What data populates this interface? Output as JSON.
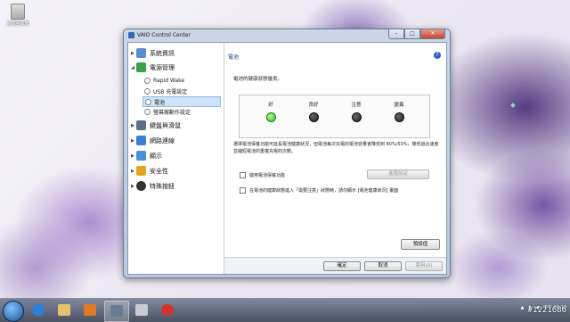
{
  "desktop": {
    "icon_label": "資源回收筒"
  },
  "window": {
    "title": "VAIO Control Center",
    "buttons": {
      "minimize": "–",
      "maximize": "□",
      "close": "✕"
    }
  },
  "sidebar": {
    "items": [
      {
        "label": "系統資訊",
        "icon": "computer-icon",
        "color": "#5b8bd0"
      },
      {
        "label": "電源管理",
        "icon": "battery-plug-icon",
        "color": "#3aa04a"
      },
      {
        "label": "鍵盤與滑鼠",
        "icon": "keyboard-icon",
        "color": "#5c6f88"
      },
      {
        "label": "網路連線",
        "icon": "network-icon",
        "color": "#3a7fd0"
      },
      {
        "label": "顯示",
        "icon": "display-icon",
        "color": "#4a90d8"
      },
      {
        "label": "安全性",
        "icon": "lock-icon",
        "color": "#e0a820"
      },
      {
        "label": "特殊按鈕",
        "icon": "special-button-icon",
        "color": "#333333"
      }
    ],
    "power_subitems": [
      {
        "label": "Rapid Wake"
      },
      {
        "label": "USB 充電設定"
      },
      {
        "label": "電池",
        "selected": true
      },
      {
        "label": "螢幕搬動作設定"
      }
    ]
  },
  "content": {
    "title": "電池",
    "help": "?",
    "health_label": "電池的健康狀態優良。",
    "levels": [
      {
        "label": "好",
        "active": true
      },
      {
        "label": "良好",
        "active": false
      },
      {
        "label": "注意",
        "active": false
      },
      {
        "label": "變異",
        "active": false
      }
    ],
    "description": "選擇電池保養功能可延長電池健康狀況，但電池每次充電的電池容量會降低到 80%/50%，降低過比速度並縮短電池的重複充電的次數。",
    "care_checkbox": "啟用電池保養功能",
    "care_settings_button": "進階設定",
    "notify_checkbox": "在電池的健康狀態進入「需要注意」狀態時，請勿顯示 [電池健康狀況] 畫面",
    "defaults_button": "預設值",
    "ok_button": "確定",
    "cancel_button": "取消",
    "apply_button": "套用(A)"
  },
  "taskbar": {
    "clock": "下午 04:19",
    "watermark": "#1221686"
  }
}
